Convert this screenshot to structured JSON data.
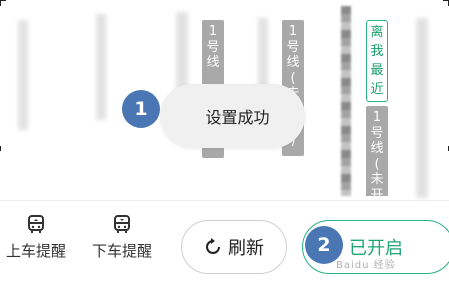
{
  "routes": [
    {
      "chars": [
        "1",
        "号",
        "线"
      ]
    },
    {
      "chars": [
        "1",
        "号",
        "线",
        "(",
        "未",
        "开",
        "通",
        ")"
      ]
    },
    {
      "chars": [
        "1",
        "号",
        "线",
        "(",
        "未",
        "开"
      ]
    }
  ],
  "nearest_badge": {
    "chars": [
      "离",
      "我",
      "最",
      "近"
    ]
  },
  "toast": {
    "text": "设置成功"
  },
  "steps": {
    "first": "1",
    "second": "2"
  },
  "bottom_bar": {
    "board_alert_label": "上车提醒",
    "alight_alert_label": "下车提醒",
    "refresh_label": "刷新",
    "enabled_label": "已开启"
  },
  "watermark": "Baidu 经验",
  "colors": {
    "accent_green": "#24b47e",
    "step_blue": "#4a77b4",
    "route_gray": "#a9a9a9"
  }
}
